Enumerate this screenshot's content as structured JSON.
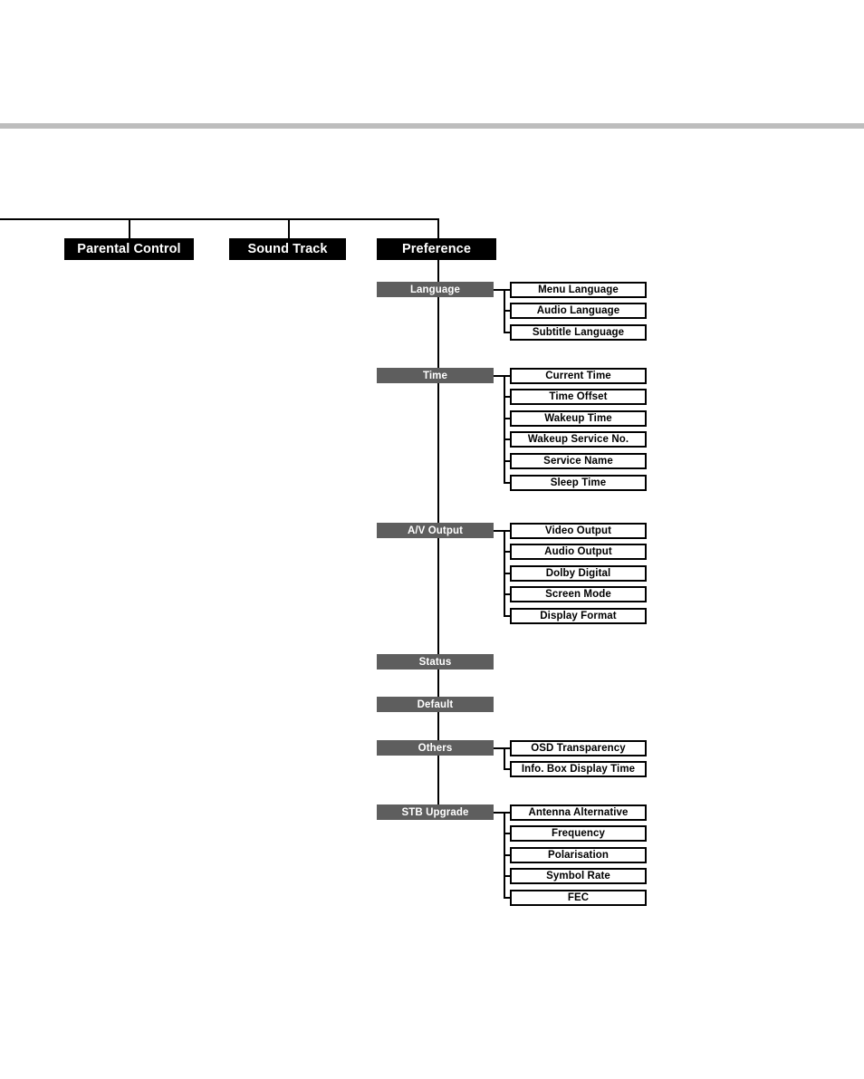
{
  "page": {
    "title": "Preference Menu Tree",
    "colors": {
      "root_bg": "#000000",
      "root_fg": "#ffffff",
      "group_bg": "#5e5e5e",
      "group_fg": "#ffffff",
      "leaf_bg": "#ffffff",
      "leaf_fg": "#000000",
      "line": "#000000",
      "header_rule": "#bdbdbd"
    }
  },
  "root_nodes": [
    {
      "label": "Parental Control"
    },
    {
      "label": "Sound Track"
    },
    {
      "label": "Preference"
    }
  ],
  "groups": [
    {
      "label": "Language",
      "children": [
        {
          "label": "Menu Language"
        },
        {
          "label": "Audio Language"
        },
        {
          "label": "Subtitle Language"
        }
      ]
    },
    {
      "label": "Time",
      "children": [
        {
          "label": "Current Time"
        },
        {
          "label": "Time Offset"
        },
        {
          "label": "Wakeup Time"
        },
        {
          "label": "Wakeup Service No."
        },
        {
          "label": "Service Name"
        },
        {
          "label": "Sleep Time"
        }
      ]
    },
    {
      "label": "A/V Output",
      "children": [
        {
          "label": "Video Output"
        },
        {
          "label": "Audio Output"
        },
        {
          "label": "Dolby Digital"
        },
        {
          "label": "Screen Mode"
        },
        {
          "label": "Display Format"
        }
      ]
    },
    {
      "label": "Status",
      "children": []
    },
    {
      "label": "Default",
      "children": []
    },
    {
      "label": "Others",
      "children": [
        {
          "label": "OSD Transparency"
        },
        {
          "label": "Info. Box Display Time"
        }
      ]
    },
    {
      "label": "STB Upgrade",
      "children": [
        {
          "label": "Antenna Alternative"
        },
        {
          "label": "Frequency"
        },
        {
          "label": "Polarisation"
        },
        {
          "label": "Symbol Rate"
        },
        {
          "label": "FEC"
        }
      ]
    }
  ]
}
